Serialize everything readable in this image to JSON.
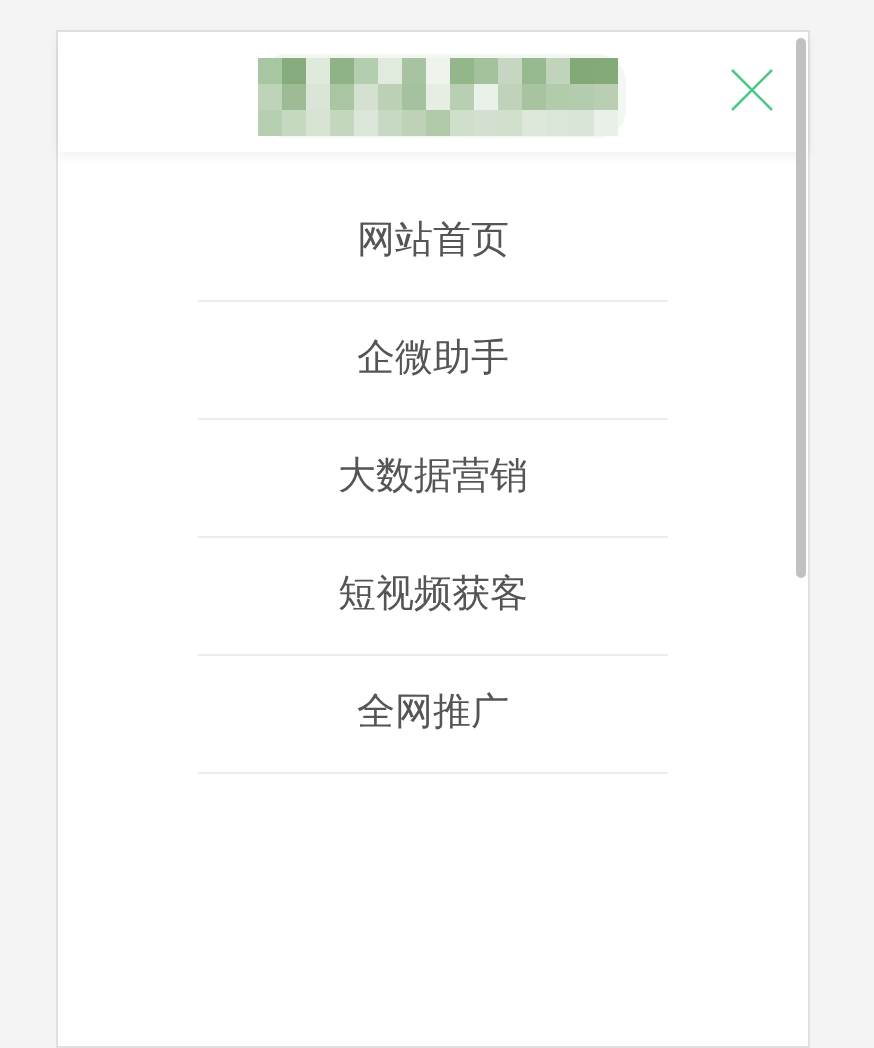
{
  "menu": {
    "items": [
      {
        "label": "网站首页"
      },
      {
        "label": "企微助手"
      },
      {
        "label": "大数据营销"
      },
      {
        "label": "短视频获客"
      },
      {
        "label": "全网推广"
      }
    ]
  }
}
